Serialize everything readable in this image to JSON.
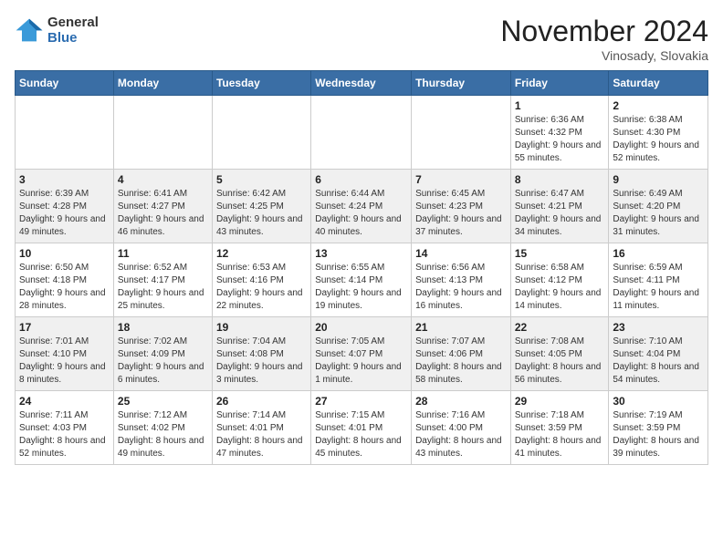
{
  "header": {
    "logo_general": "General",
    "logo_blue": "Blue",
    "month_title": "November 2024",
    "subtitle": "Vinosady, Slovakia"
  },
  "days_of_week": [
    "Sunday",
    "Monday",
    "Tuesday",
    "Wednesday",
    "Thursday",
    "Friday",
    "Saturday"
  ],
  "weeks": [
    {
      "days": [
        {
          "num": "",
          "detail": ""
        },
        {
          "num": "",
          "detail": ""
        },
        {
          "num": "",
          "detail": ""
        },
        {
          "num": "",
          "detail": ""
        },
        {
          "num": "",
          "detail": ""
        },
        {
          "num": "1",
          "detail": "Sunrise: 6:36 AM\nSunset: 4:32 PM\nDaylight: 9 hours and 55 minutes."
        },
        {
          "num": "2",
          "detail": "Sunrise: 6:38 AM\nSunset: 4:30 PM\nDaylight: 9 hours and 52 minutes."
        }
      ]
    },
    {
      "days": [
        {
          "num": "3",
          "detail": "Sunrise: 6:39 AM\nSunset: 4:28 PM\nDaylight: 9 hours and 49 minutes."
        },
        {
          "num": "4",
          "detail": "Sunrise: 6:41 AM\nSunset: 4:27 PM\nDaylight: 9 hours and 46 minutes."
        },
        {
          "num": "5",
          "detail": "Sunrise: 6:42 AM\nSunset: 4:25 PM\nDaylight: 9 hours and 43 minutes."
        },
        {
          "num": "6",
          "detail": "Sunrise: 6:44 AM\nSunset: 4:24 PM\nDaylight: 9 hours and 40 minutes."
        },
        {
          "num": "7",
          "detail": "Sunrise: 6:45 AM\nSunset: 4:23 PM\nDaylight: 9 hours and 37 minutes."
        },
        {
          "num": "8",
          "detail": "Sunrise: 6:47 AM\nSunset: 4:21 PM\nDaylight: 9 hours and 34 minutes."
        },
        {
          "num": "9",
          "detail": "Sunrise: 6:49 AM\nSunset: 4:20 PM\nDaylight: 9 hours and 31 minutes."
        }
      ]
    },
    {
      "days": [
        {
          "num": "10",
          "detail": "Sunrise: 6:50 AM\nSunset: 4:18 PM\nDaylight: 9 hours and 28 minutes."
        },
        {
          "num": "11",
          "detail": "Sunrise: 6:52 AM\nSunset: 4:17 PM\nDaylight: 9 hours and 25 minutes."
        },
        {
          "num": "12",
          "detail": "Sunrise: 6:53 AM\nSunset: 4:16 PM\nDaylight: 9 hours and 22 minutes."
        },
        {
          "num": "13",
          "detail": "Sunrise: 6:55 AM\nSunset: 4:14 PM\nDaylight: 9 hours and 19 minutes."
        },
        {
          "num": "14",
          "detail": "Sunrise: 6:56 AM\nSunset: 4:13 PM\nDaylight: 9 hours and 16 minutes."
        },
        {
          "num": "15",
          "detail": "Sunrise: 6:58 AM\nSunset: 4:12 PM\nDaylight: 9 hours and 14 minutes."
        },
        {
          "num": "16",
          "detail": "Sunrise: 6:59 AM\nSunset: 4:11 PM\nDaylight: 9 hours and 11 minutes."
        }
      ]
    },
    {
      "days": [
        {
          "num": "17",
          "detail": "Sunrise: 7:01 AM\nSunset: 4:10 PM\nDaylight: 9 hours and 8 minutes."
        },
        {
          "num": "18",
          "detail": "Sunrise: 7:02 AM\nSunset: 4:09 PM\nDaylight: 9 hours and 6 minutes."
        },
        {
          "num": "19",
          "detail": "Sunrise: 7:04 AM\nSunset: 4:08 PM\nDaylight: 9 hours and 3 minutes."
        },
        {
          "num": "20",
          "detail": "Sunrise: 7:05 AM\nSunset: 4:07 PM\nDaylight: 9 hours and 1 minute."
        },
        {
          "num": "21",
          "detail": "Sunrise: 7:07 AM\nSunset: 4:06 PM\nDaylight: 8 hours and 58 minutes."
        },
        {
          "num": "22",
          "detail": "Sunrise: 7:08 AM\nSunset: 4:05 PM\nDaylight: 8 hours and 56 minutes."
        },
        {
          "num": "23",
          "detail": "Sunrise: 7:10 AM\nSunset: 4:04 PM\nDaylight: 8 hours and 54 minutes."
        }
      ]
    },
    {
      "days": [
        {
          "num": "24",
          "detail": "Sunrise: 7:11 AM\nSunset: 4:03 PM\nDaylight: 8 hours and 52 minutes."
        },
        {
          "num": "25",
          "detail": "Sunrise: 7:12 AM\nSunset: 4:02 PM\nDaylight: 8 hours and 49 minutes."
        },
        {
          "num": "26",
          "detail": "Sunrise: 7:14 AM\nSunset: 4:01 PM\nDaylight: 8 hours and 47 minutes."
        },
        {
          "num": "27",
          "detail": "Sunrise: 7:15 AM\nSunset: 4:01 PM\nDaylight: 8 hours and 45 minutes."
        },
        {
          "num": "28",
          "detail": "Sunrise: 7:16 AM\nSunset: 4:00 PM\nDaylight: 8 hours and 43 minutes."
        },
        {
          "num": "29",
          "detail": "Sunrise: 7:18 AM\nSunset: 3:59 PM\nDaylight: 8 hours and 41 minutes."
        },
        {
          "num": "30",
          "detail": "Sunrise: 7:19 AM\nSunset: 3:59 PM\nDaylight: 8 hours and 39 minutes."
        }
      ]
    }
  ]
}
